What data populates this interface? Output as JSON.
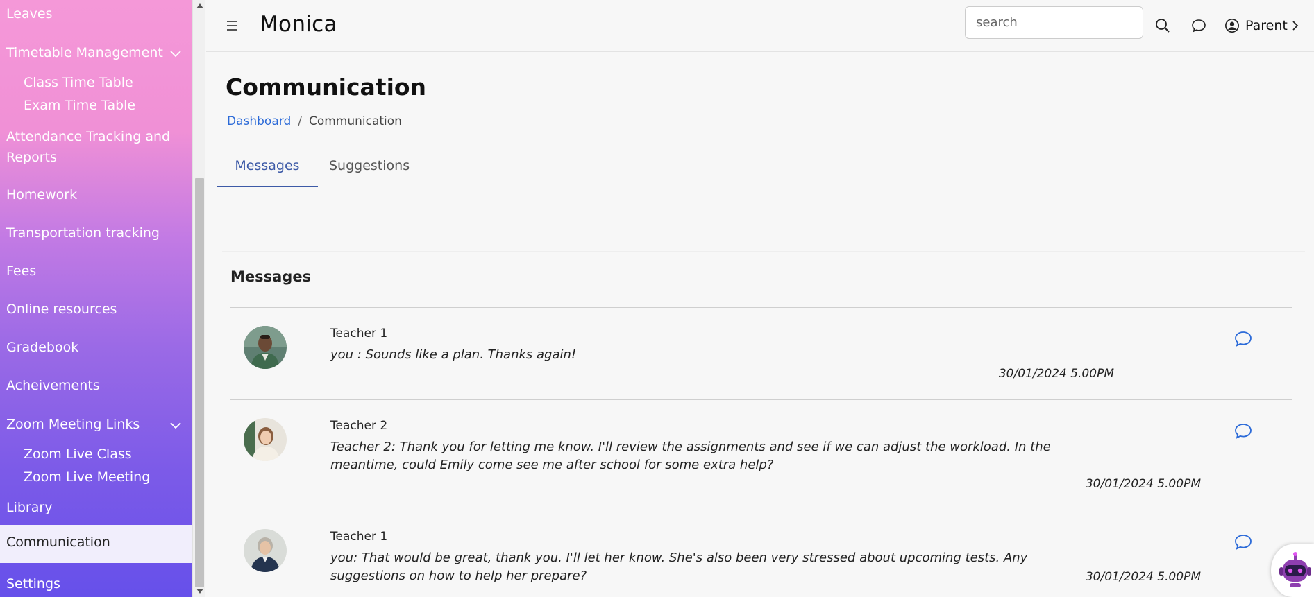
{
  "sidebar": {
    "items": {
      "leaves": "Leaves",
      "timetable": "Timetable Management",
      "class_tt": "Class Time Table",
      "exam_tt": "Exam Time Table",
      "attendance": "Attendance Tracking and Reports",
      "homework": "Homework",
      "transport": "Transportation tracking",
      "fees": "Fees",
      "online": "Online resources",
      "gradebook": "Gradebook",
      "achievements": "Acheivements",
      "zoom": "Zoom Meeting Links",
      "zoom_class": "Zoom Live Class",
      "zoom_meeting": "Zoom Live Meeting",
      "library": "Library",
      "communication": "Communication",
      "settings": "Settings"
    }
  },
  "header": {
    "brand": "Monica",
    "search_placeholder": "search",
    "user_label": "Parent"
  },
  "page": {
    "title": "Communication",
    "breadcrumb_home": "Dashboard",
    "breadcrumb_separator": "/",
    "breadcrumb_current": "Communication"
  },
  "tabs": {
    "messages": "Messages",
    "suggestions": "Suggestions"
  },
  "messages": {
    "title": "Messages",
    "list": [
      {
        "name": "Teacher 1",
        "text": "you : Sounds like a plan. Thanks again!",
        "time": "30/01/2024 5.00PM"
      },
      {
        "name": "Teacher 2",
        "text": "Teacher 2: Thank you for letting me know. I'll review the assignments and see if we can adjust the workload. In the meantime, could Emily come see me after school for some extra help?",
        "time": "30/01/2024 5.00PM"
      },
      {
        "name": "Teacher 1",
        "text": "you: That would be great, thank you. I'll let her know. She's also been very stressed about upcoming tests. Any suggestions on how to help her prepare?",
        "time": "30/01/2024 5.00PM"
      }
    ]
  },
  "colors": {
    "accent": "#3d5aa7",
    "link": "#2b6ad8",
    "chat_icon": "#2b6ad8"
  },
  "icons": {
    "menu": "hamburger-icon",
    "search": "search-icon",
    "chat": "chat-bubble-icon",
    "user": "user-circle-icon",
    "chevron": "chevron-right-icon",
    "expand": "chevron-down-icon",
    "bot": "chatbot-icon"
  }
}
